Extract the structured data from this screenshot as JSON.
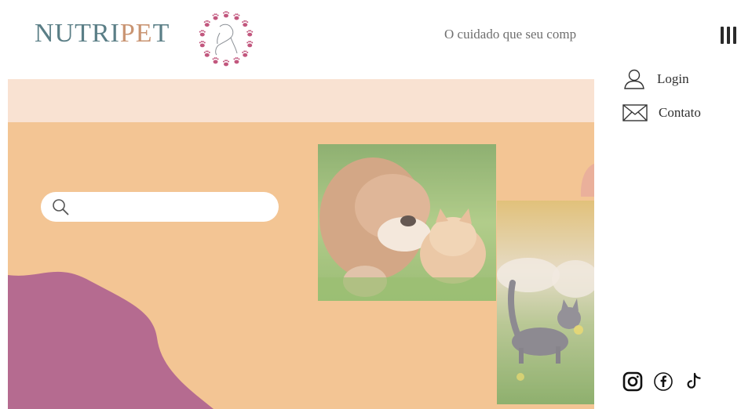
{
  "header": {
    "brand_prefix": "NUTRI",
    "brand_highlight": "PE",
    "brand_suffix": "T",
    "tagline": "O cuidado que seu comp",
    "menu_icon": "hamburger-icon"
  },
  "side_menu": {
    "items": [
      {
        "label": "Login",
        "icon": "user-icon"
      },
      {
        "label": "Contato",
        "icon": "mail-icon"
      }
    ],
    "socials": [
      {
        "icon": "instagram-icon"
      },
      {
        "icon": "facebook-icon"
      },
      {
        "icon": "tiktok-icon"
      }
    ]
  },
  "hero": {
    "search": {
      "value": "",
      "placeholder": "",
      "icon": "search-icon"
    },
    "images": [
      {
        "subject": "bulldog puppy and orange kitten on grass"
      },
      {
        "subject": "gray cat walking in a meadow"
      }
    ]
  },
  "colors": {
    "brand_teal": "#5a7e86",
    "brand_tan": "#c99472",
    "hero_peach": "#f3c594",
    "hero_band": "#f9e2d2",
    "blob_mauve": "#b56b90",
    "paw_pink": "#c2577e"
  }
}
